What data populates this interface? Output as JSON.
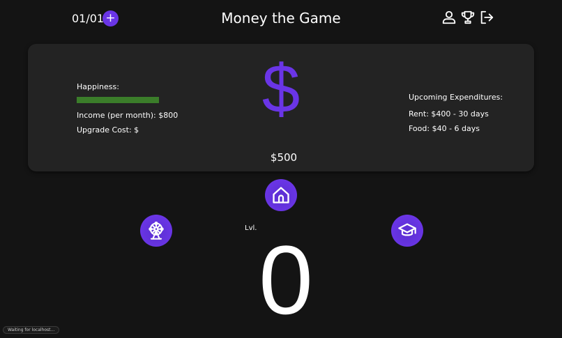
{
  "header": {
    "date": "01/01",
    "add_symbol": "+",
    "title": "Money the Game",
    "icons": [
      "user-icon",
      "trophy-icon",
      "logout-icon"
    ]
  },
  "stats": {
    "happiness_label": "Happiness:",
    "happiness_level": 1.0,
    "happiness_color": "#3b7d2a",
    "income": "Income (per month): $800",
    "upgrade_cost": "Upgrade Cost: $"
  },
  "money": {
    "symbol": "$",
    "balance": "$500",
    "accent_color": "#6a35e6"
  },
  "expenditures": {
    "title": "Upcoming Expenditures:",
    "rent": "Rent: $400 - 30 days",
    "food": "Food: $40 - 6 days"
  },
  "actions": [
    "house-icon",
    "ferris-wheel-icon",
    "graduation-cap-icon"
  ],
  "level": {
    "label": "Lvl.",
    "value": "0"
  },
  "status_bar": {
    "text": "Waiting for localhost..."
  }
}
